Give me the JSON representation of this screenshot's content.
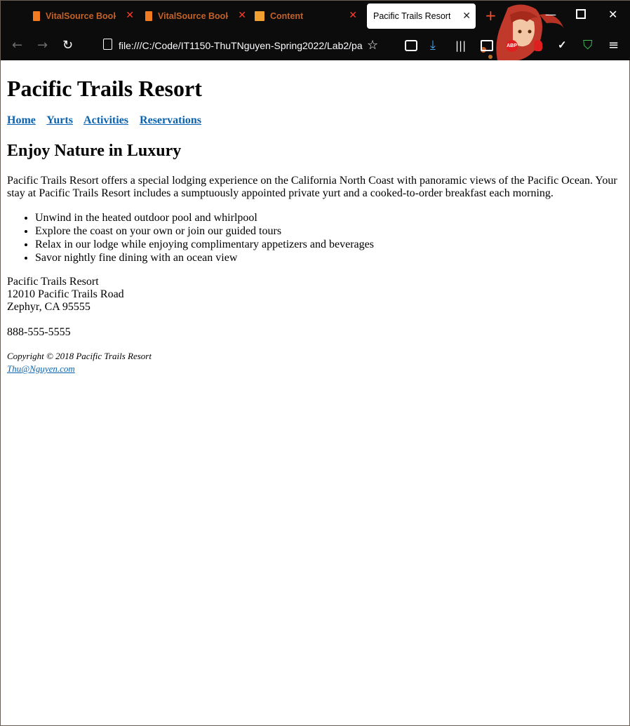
{
  "browser": {
    "tabs": [
      {
        "title": "VitalSource Booksh",
        "icon_color": "#f07b21",
        "active": false
      },
      {
        "title": "VitalSource Booksh",
        "icon_color": "#f07b21",
        "active": false
      },
      {
        "title": "Content",
        "icon_color": "#f0a030",
        "active": false
      },
      {
        "title": "Pacific Trails Resort",
        "icon_color": "",
        "active": true
      }
    ],
    "url": "file:///C:/Code/IT1150-ThuTNguyen-Spring2022/Lab2/pa",
    "extensions": [
      "ABP"
    ]
  },
  "page": {
    "title": "Pacific Trails Resort",
    "nav": [
      "Home",
      "Yurts",
      "Activities",
      "Reservations"
    ],
    "heading": "Enjoy Nature in Luxury",
    "intro": "Pacific Trails Resort offers a special lodging experience on the California North Coast with panoramic views of the Pacific Ocean. Your stay at Pacific Trails Resort includes a sumptuously appointed private yurt and a cooked-to-order breakfast each morning.",
    "features": [
      "Unwind in the heated outdoor pool and whirlpool",
      "Explore the coast on your own or join our guided tours",
      "Relax in our lodge while enjoying complimentary appetizers and beverages",
      "Savor nightly fine dining with an ocean view"
    ],
    "address": {
      "name": "Pacific Trails Resort",
      "street": "12010 Pacific Trails Road",
      "city": "Zephyr, CA 95555"
    },
    "phone": "888-555-5555",
    "copyright": "Copyright © 2018 Pacific Trails Resort",
    "email": "Thu@Nguyen.com"
  }
}
